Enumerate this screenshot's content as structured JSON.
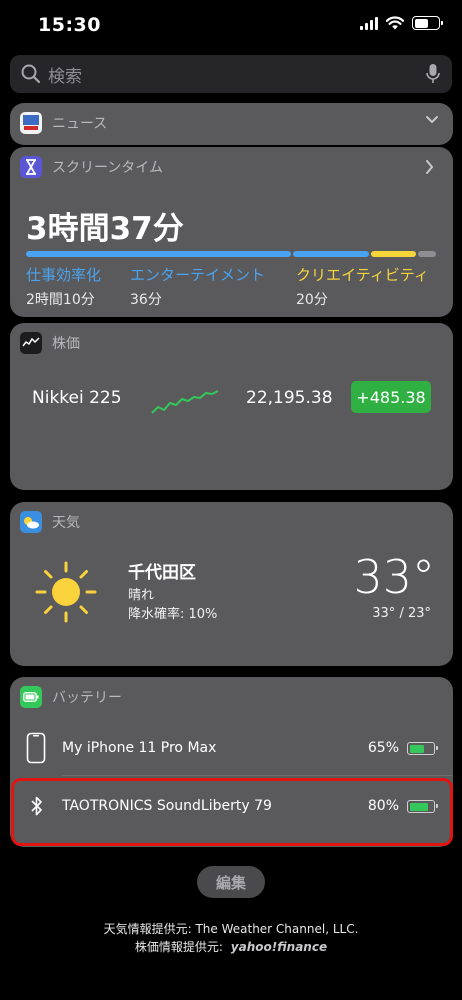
{
  "status": {
    "time": "15:30"
  },
  "search": {
    "placeholder": "検索"
  },
  "news": {
    "title": "ニュース",
    "icon": "yahoo-news-icon"
  },
  "screentime": {
    "title": "スクリーンタイム",
    "total": "3時間37分",
    "categories": [
      {
        "name": "仕事効率化",
        "value": "2時間10分",
        "color": "#4aa3f0",
        "share": 0.655
      },
      {
        "name": "エンターテイメント",
        "value": "36分",
        "color": "#4aa3f0",
        "share": 0.19
      },
      {
        "name": "クリエイティビティ",
        "value": "20分",
        "color": "#f5d53a",
        "share": 0.11
      }
    ],
    "other_color": "#8e8e93"
  },
  "stocks": {
    "title": "株価",
    "name": "Nikkei 225",
    "price": "22,195.38",
    "change": "+485.38",
    "change_color": "#30b043"
  },
  "weather": {
    "title": "天気",
    "city": "千代田区",
    "condition": "晴れ",
    "rain": "降水確率: 10%",
    "temp": "33°",
    "range": "33° / 23°"
  },
  "battery": {
    "title": "バッテリー",
    "devices": [
      {
        "name": "My iPhone 11 Pro Max",
        "percent": "65%",
        "level": 0.65,
        "icon": "iphone-icon"
      },
      {
        "name": "TAOTRONICS SoundLiberty 79",
        "percent": "80%",
        "level": 0.8,
        "icon": "bluetooth-icon"
      }
    ]
  },
  "edit_label": "編集",
  "credits": {
    "weather": "天気情報提供元: The Weather Channel, LLC.",
    "stock_prefix": "株価情報提供元:",
    "stock_brand": "yahoo!finance"
  }
}
